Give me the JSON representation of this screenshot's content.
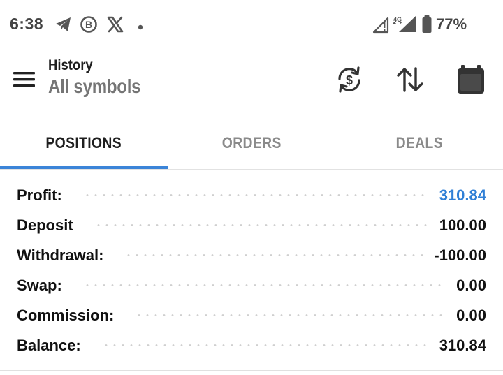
{
  "status_bar": {
    "time": "6:38",
    "battery_percent": "77%",
    "network": "4G",
    "icons": [
      "telegram-icon",
      "b-circle-icon",
      "x-logo-icon",
      "notification-dot-icon",
      "signal-icon",
      "battery-icon"
    ]
  },
  "toolbar": {
    "title": "History",
    "subtitle": "All symbols",
    "icons": [
      "menu-icon",
      "currency-exchange-icon",
      "sort-icon",
      "calendar-icon"
    ]
  },
  "tabs": [
    {
      "label": "POSITIONS",
      "active": true
    },
    {
      "label": "ORDERS",
      "active": false
    },
    {
      "label": "DEALS",
      "active": false
    }
  ],
  "summary": [
    {
      "label": "Profit:",
      "value": "310.84"
    },
    {
      "label": "Deposit",
      "value": "100.00"
    },
    {
      "label": "Withdrawal:",
      "value": "-100.00"
    },
    {
      "label": "Swap:",
      "value": "0.00"
    },
    {
      "label": "Commission:",
      "value": "0.00"
    },
    {
      "label": "Balance:",
      "value": "310.84"
    }
  ],
  "colors": {
    "accent": "#3b84d8",
    "profit_value": "#2f7fd6",
    "inactive_tab": "#8a8a8a",
    "subtitle": "#757575"
  }
}
